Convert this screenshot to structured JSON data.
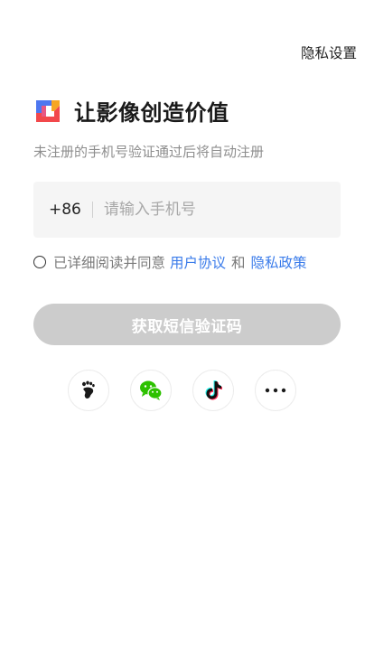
{
  "header": {
    "privacy_settings_label": "隐私设置"
  },
  "brand": {
    "headline": "让影像创造价值",
    "logo_colors": [
      "#f2484b",
      "#4d77f0",
      "#f6a623"
    ]
  },
  "login": {
    "subtitle": "未注册的手机号验证通过后将自动注册",
    "country_code": "+86",
    "phone_placeholder": "请输入手机号",
    "phone_value": ""
  },
  "agreement": {
    "prefix": "已详细阅读并同意",
    "user_agreement": "用户协议",
    "connector": "和",
    "privacy_policy": "隐私政策",
    "checked": false
  },
  "actions": {
    "get_code_label": "获取短信验证码"
  },
  "social": {
    "items": [
      {
        "name": "footprint-icon",
        "color": "#1a1a1a"
      },
      {
        "name": "wechat-icon",
        "color": "#2dc100"
      },
      {
        "name": "douyin-icon",
        "color": "#111111"
      },
      {
        "name": "more-icon",
        "color": "#1a1a1a"
      }
    ]
  },
  "colors": {
    "accent_blue": "#3a7bea",
    "button_disabled": "#cccccc",
    "input_bg": "#f5f5f5"
  }
}
